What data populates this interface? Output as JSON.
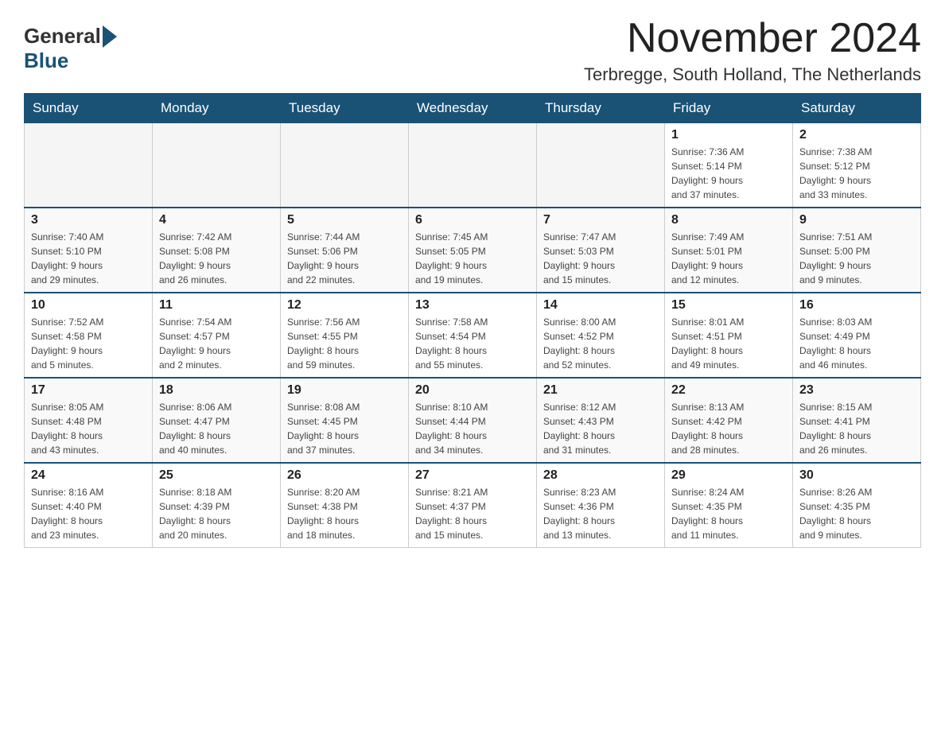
{
  "header": {
    "logo_general": "General",
    "logo_blue": "Blue",
    "month_title": "November 2024",
    "location": "Terbregge, South Holland, The Netherlands"
  },
  "days_of_week": [
    "Sunday",
    "Monday",
    "Tuesday",
    "Wednesday",
    "Thursday",
    "Friday",
    "Saturday"
  ],
  "weeks": [
    [
      {
        "day": "",
        "info": ""
      },
      {
        "day": "",
        "info": ""
      },
      {
        "day": "",
        "info": ""
      },
      {
        "day": "",
        "info": ""
      },
      {
        "day": "",
        "info": ""
      },
      {
        "day": "1",
        "info": "Sunrise: 7:36 AM\nSunset: 5:14 PM\nDaylight: 9 hours\nand 37 minutes."
      },
      {
        "day": "2",
        "info": "Sunrise: 7:38 AM\nSunset: 5:12 PM\nDaylight: 9 hours\nand 33 minutes."
      }
    ],
    [
      {
        "day": "3",
        "info": "Sunrise: 7:40 AM\nSunset: 5:10 PM\nDaylight: 9 hours\nand 29 minutes."
      },
      {
        "day": "4",
        "info": "Sunrise: 7:42 AM\nSunset: 5:08 PM\nDaylight: 9 hours\nand 26 minutes."
      },
      {
        "day": "5",
        "info": "Sunrise: 7:44 AM\nSunset: 5:06 PM\nDaylight: 9 hours\nand 22 minutes."
      },
      {
        "day": "6",
        "info": "Sunrise: 7:45 AM\nSunset: 5:05 PM\nDaylight: 9 hours\nand 19 minutes."
      },
      {
        "day": "7",
        "info": "Sunrise: 7:47 AM\nSunset: 5:03 PM\nDaylight: 9 hours\nand 15 minutes."
      },
      {
        "day": "8",
        "info": "Sunrise: 7:49 AM\nSunset: 5:01 PM\nDaylight: 9 hours\nand 12 minutes."
      },
      {
        "day": "9",
        "info": "Sunrise: 7:51 AM\nSunset: 5:00 PM\nDaylight: 9 hours\nand 9 minutes."
      }
    ],
    [
      {
        "day": "10",
        "info": "Sunrise: 7:52 AM\nSunset: 4:58 PM\nDaylight: 9 hours\nand 5 minutes."
      },
      {
        "day": "11",
        "info": "Sunrise: 7:54 AM\nSunset: 4:57 PM\nDaylight: 9 hours\nand 2 minutes."
      },
      {
        "day": "12",
        "info": "Sunrise: 7:56 AM\nSunset: 4:55 PM\nDaylight: 8 hours\nand 59 minutes."
      },
      {
        "day": "13",
        "info": "Sunrise: 7:58 AM\nSunset: 4:54 PM\nDaylight: 8 hours\nand 55 minutes."
      },
      {
        "day": "14",
        "info": "Sunrise: 8:00 AM\nSunset: 4:52 PM\nDaylight: 8 hours\nand 52 minutes."
      },
      {
        "day": "15",
        "info": "Sunrise: 8:01 AM\nSunset: 4:51 PM\nDaylight: 8 hours\nand 49 minutes."
      },
      {
        "day": "16",
        "info": "Sunrise: 8:03 AM\nSunset: 4:49 PM\nDaylight: 8 hours\nand 46 minutes."
      }
    ],
    [
      {
        "day": "17",
        "info": "Sunrise: 8:05 AM\nSunset: 4:48 PM\nDaylight: 8 hours\nand 43 minutes."
      },
      {
        "day": "18",
        "info": "Sunrise: 8:06 AM\nSunset: 4:47 PM\nDaylight: 8 hours\nand 40 minutes."
      },
      {
        "day": "19",
        "info": "Sunrise: 8:08 AM\nSunset: 4:45 PM\nDaylight: 8 hours\nand 37 minutes."
      },
      {
        "day": "20",
        "info": "Sunrise: 8:10 AM\nSunset: 4:44 PM\nDaylight: 8 hours\nand 34 minutes."
      },
      {
        "day": "21",
        "info": "Sunrise: 8:12 AM\nSunset: 4:43 PM\nDaylight: 8 hours\nand 31 minutes."
      },
      {
        "day": "22",
        "info": "Sunrise: 8:13 AM\nSunset: 4:42 PM\nDaylight: 8 hours\nand 28 minutes."
      },
      {
        "day": "23",
        "info": "Sunrise: 8:15 AM\nSunset: 4:41 PM\nDaylight: 8 hours\nand 26 minutes."
      }
    ],
    [
      {
        "day": "24",
        "info": "Sunrise: 8:16 AM\nSunset: 4:40 PM\nDaylight: 8 hours\nand 23 minutes."
      },
      {
        "day": "25",
        "info": "Sunrise: 8:18 AM\nSunset: 4:39 PM\nDaylight: 8 hours\nand 20 minutes."
      },
      {
        "day": "26",
        "info": "Sunrise: 8:20 AM\nSunset: 4:38 PM\nDaylight: 8 hours\nand 18 minutes."
      },
      {
        "day": "27",
        "info": "Sunrise: 8:21 AM\nSunset: 4:37 PM\nDaylight: 8 hours\nand 15 minutes."
      },
      {
        "day": "28",
        "info": "Sunrise: 8:23 AM\nSunset: 4:36 PM\nDaylight: 8 hours\nand 13 minutes."
      },
      {
        "day": "29",
        "info": "Sunrise: 8:24 AM\nSunset: 4:35 PM\nDaylight: 8 hours\nand 11 minutes."
      },
      {
        "day": "30",
        "info": "Sunrise: 8:26 AM\nSunset: 4:35 PM\nDaylight: 8 hours\nand 9 minutes."
      }
    ]
  ]
}
